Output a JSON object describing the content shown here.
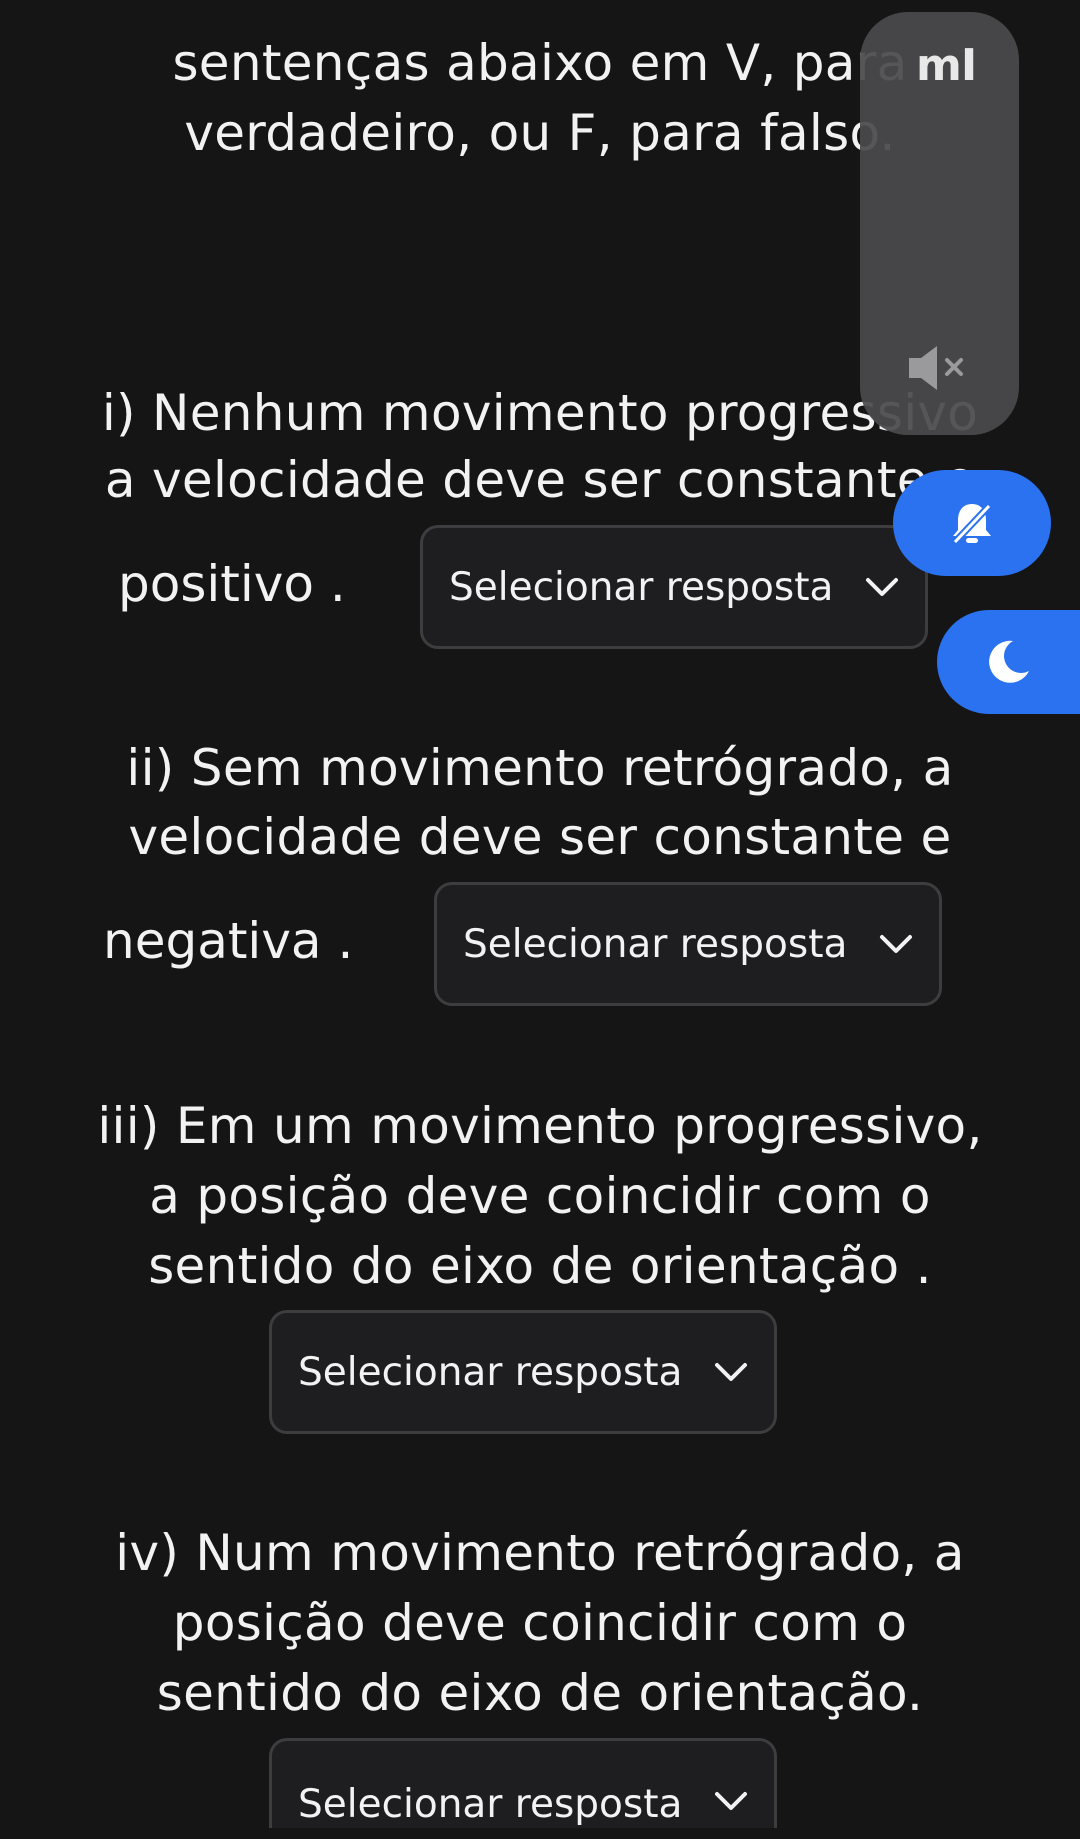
{
  "question": {
    "intro_lines": [
      "sentenças abaixo em V, para",
      "verdadeiro, ou F, para falso."
    ],
    "items": [
      {
        "lines": [
          "i) Nenhum movimento progressivo",
          "a velocidade deve ser constante e"
        ],
        "tail": "positivo .",
        "select_value": "Selecionar resposta"
      },
      {
        "lines": [
          "ii) Sem movimento retrógrado, a",
          "velocidade deve ser constante e"
        ],
        "tail": "negativa .",
        "select_value": "Selecionar resposta"
      },
      {
        "lines": [
          "iii) Em um movimento progressivo,",
          "a posição deve coincidir com o",
          "sentido do eixo de orientação ."
        ],
        "select_value": "Selecionar resposta"
      },
      {
        "lines": [
          "iv) Num movimento retrógrado, a",
          "posição deve coincidir com o",
          "sentido do eixo de orientação."
        ],
        "select_value": "Selecionar resposta"
      }
    ]
  },
  "overlay": {
    "brand_logo": "mI",
    "volume_icon": "speaker-muted-icon",
    "silent_toggle_icon": "bell-off-icon",
    "dnd_toggle_icon": "moon-icon",
    "accent_color": "#2a72f0",
    "panel_color": "#4a4a4c"
  },
  "colors": {
    "background": "#151516",
    "text": "#f2f2f2",
    "select_border": "#3d3d3f",
    "select_fill": "#1e1e20"
  }
}
